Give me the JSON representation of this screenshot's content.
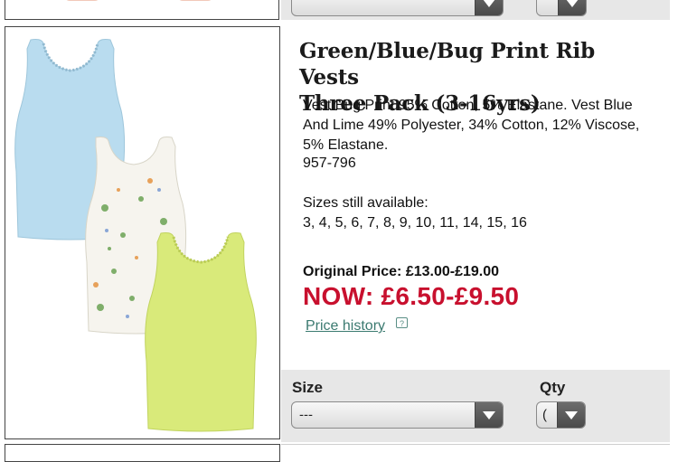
{
  "product": {
    "title_line1": "Green/Blue/Bug Print Rib Vests",
    "title_line2": "Three Pack (3-16yrs)",
    "description": "Vest Bug Print 95% Cotton, 5% Elastane. Vest Blue And Lime 49% Polyester, 34% Cotton, 12% Viscose, 5% Elastane.",
    "code": "957-796",
    "sizes_label": "Sizes still available:",
    "sizes": "3, 4, 5, 6, 7, 8, 9, 10, 11, 14, 15, 16",
    "original_price": "Original Price: £13.00-£19.00",
    "now_price": "NOW: £6.50-£9.50",
    "price_history_link": "Price history",
    "help_icon": "?"
  },
  "form": {
    "size_label": "Size",
    "size_value": "---",
    "qty_label": "Qty",
    "qty_value": "("
  },
  "colors": {
    "now_price": "#c8102e",
    "link": "#3b7a70",
    "form_band": "#e7e7e7",
    "vest_blue": "#b9dcef",
    "vest_lime": "#d9ea7a",
    "vest_print": "#f6f4ee"
  },
  "icons": {
    "dropdown": "chevron-down-icon",
    "help": "help-icon"
  }
}
